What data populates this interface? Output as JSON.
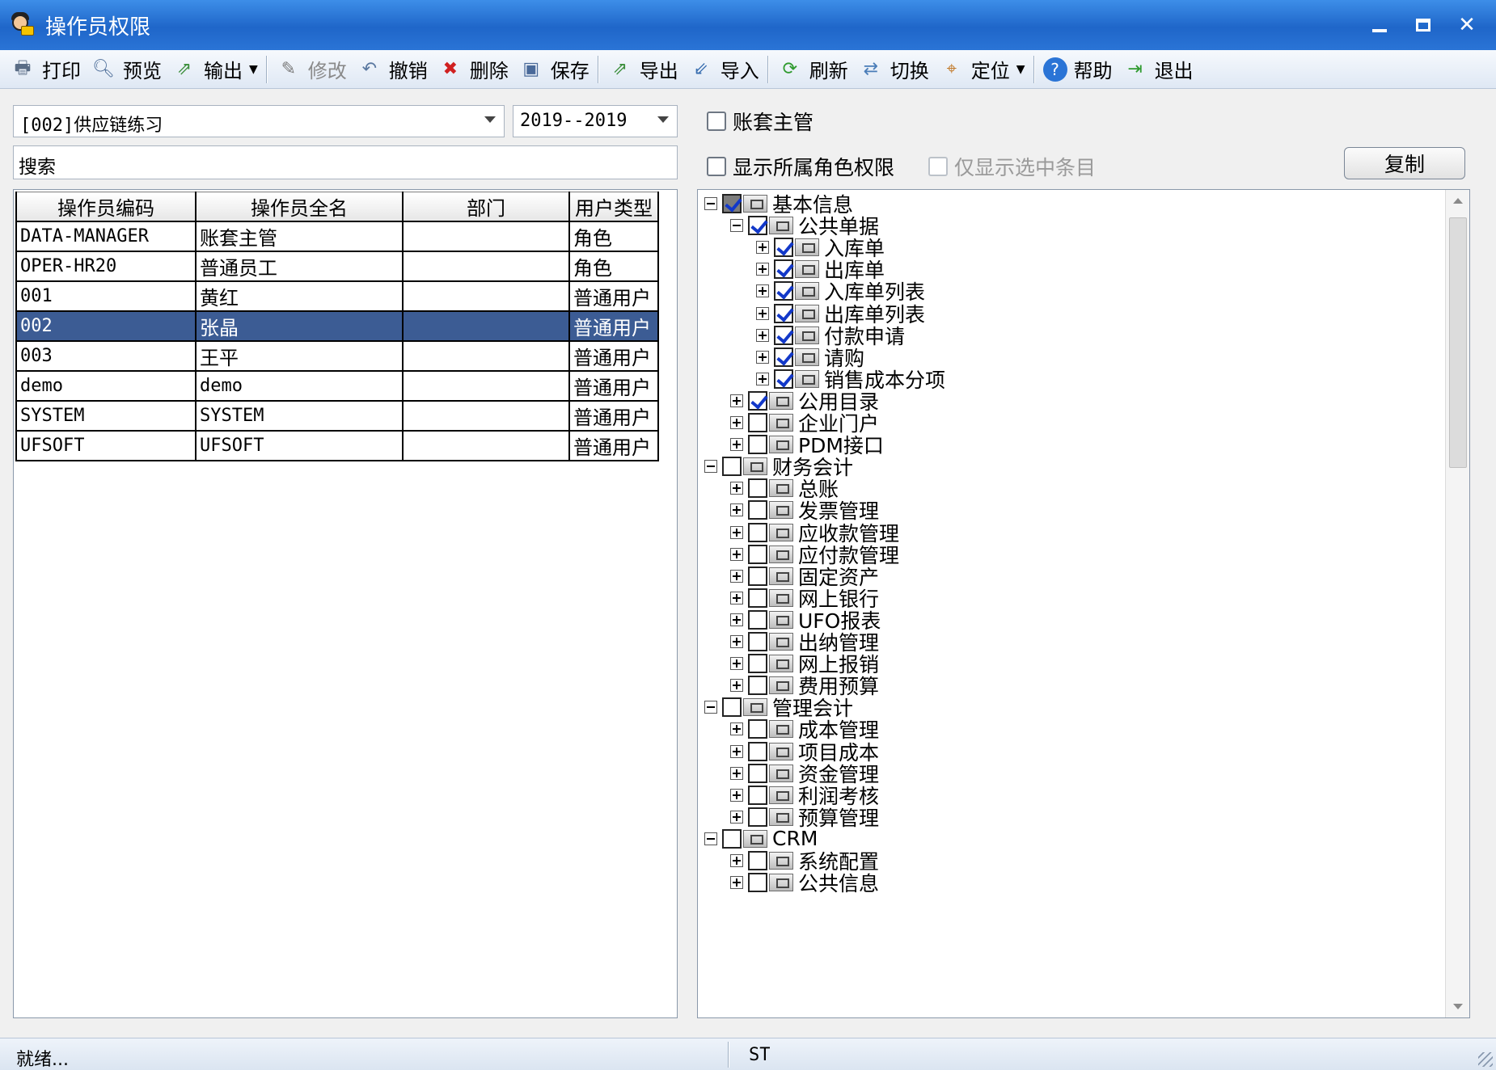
{
  "window": {
    "title": "操作员权限"
  },
  "toolbar": {
    "print": "打印",
    "preview": "预览",
    "output": "输出",
    "modify": "修改",
    "undo": "撤销",
    "delete": "删除",
    "save": "保存",
    "export": "导出",
    "import": "导入",
    "refresh": "刷新",
    "switch": "切换",
    "locate": "定位",
    "help": "帮助",
    "exit": "退出"
  },
  "left": {
    "account": "[002]供应链练习",
    "year": "2019--2019",
    "search": "搜索",
    "columns": [
      "操作员编码",
      "操作员全名",
      "部门",
      "用户类型"
    ],
    "rows": [
      [
        "DATA-MANAGER",
        "账套主管",
        "",
        "角色"
      ],
      [
        "OPER-HR20",
        "普通员工",
        "",
        "角色"
      ],
      [
        "001",
        "黄红",
        "",
        "普通用户"
      ],
      [
        "002",
        "张晶",
        "",
        "普通用户"
      ],
      [
        "003",
        "王平",
        "",
        "普通用户"
      ],
      [
        "demo",
        "demo",
        "",
        "普通用户"
      ],
      [
        "SYSTEM",
        "SYSTEM",
        "",
        "普通用户"
      ],
      [
        "UFSOFT",
        "UFSOFT",
        "",
        "普通用户"
      ]
    ],
    "selected_row": 3
  },
  "right": {
    "account_supervisor": "账套主管",
    "show_role_perms": "显示所属角色权限",
    "show_selected_only": "仅显示选中条目",
    "copy": "复制",
    "tree": [
      {
        "label": "基本信息",
        "level": 0,
        "expanded": true,
        "state": "partial"
      },
      {
        "label": "公共单据",
        "level": 1,
        "expanded": true,
        "state": "on"
      },
      {
        "label": "入库单",
        "level": 2,
        "expanded": false,
        "state": "on"
      },
      {
        "label": "出库单",
        "level": 2,
        "expanded": false,
        "state": "on"
      },
      {
        "label": "入库单列表",
        "level": 2,
        "expanded": false,
        "state": "on"
      },
      {
        "label": "出库单列表",
        "level": 2,
        "expanded": false,
        "state": "on"
      },
      {
        "label": "付款申请",
        "level": 2,
        "expanded": false,
        "state": "on"
      },
      {
        "label": "请购",
        "level": 2,
        "expanded": false,
        "state": "on"
      },
      {
        "label": "销售成本分项",
        "level": 2,
        "expanded": false,
        "state": "on"
      },
      {
        "label": "公用目录",
        "level": 1,
        "expanded": false,
        "state": "on"
      },
      {
        "label": "企业门户",
        "level": 1,
        "expanded": false,
        "state": "off"
      },
      {
        "label": "PDM接口",
        "level": 1,
        "expanded": false,
        "state": "off"
      },
      {
        "label": "财务会计",
        "level": 0,
        "expanded": true,
        "state": "off"
      },
      {
        "label": "总账",
        "level": 1,
        "expanded": false,
        "state": "off"
      },
      {
        "label": "发票管理",
        "level": 1,
        "expanded": false,
        "state": "off"
      },
      {
        "label": "应收款管理",
        "level": 1,
        "expanded": false,
        "state": "off"
      },
      {
        "label": "应付款管理",
        "level": 1,
        "expanded": false,
        "state": "off"
      },
      {
        "label": "固定资产",
        "level": 1,
        "expanded": false,
        "state": "off"
      },
      {
        "label": "网上银行",
        "level": 1,
        "expanded": false,
        "state": "off"
      },
      {
        "label": "UFO报表",
        "level": 1,
        "expanded": false,
        "state": "off"
      },
      {
        "label": "出纳管理",
        "level": 1,
        "expanded": false,
        "state": "off"
      },
      {
        "label": "网上报销",
        "level": 1,
        "expanded": false,
        "state": "off"
      },
      {
        "label": "费用预算",
        "level": 1,
        "expanded": false,
        "state": "off"
      },
      {
        "label": "管理会计",
        "level": 0,
        "expanded": true,
        "state": "off"
      },
      {
        "label": "成本管理",
        "level": 1,
        "expanded": false,
        "state": "off"
      },
      {
        "label": "项目成本",
        "level": 1,
        "expanded": false,
        "state": "off"
      },
      {
        "label": "资金管理",
        "level": 1,
        "expanded": false,
        "state": "off"
      },
      {
        "label": "利润考核",
        "level": 1,
        "expanded": false,
        "state": "off"
      },
      {
        "label": "预算管理",
        "level": 1,
        "expanded": false,
        "state": "off"
      },
      {
        "label": "CRM",
        "level": 0,
        "expanded": true,
        "state": "off"
      },
      {
        "label": "系统配置",
        "level": 1,
        "expanded": false,
        "state": "off"
      },
      {
        "label": "公共信息",
        "level": 1,
        "expanded": false,
        "state": "off"
      }
    ]
  },
  "status": {
    "left": "就绪...",
    "right": "ST"
  }
}
